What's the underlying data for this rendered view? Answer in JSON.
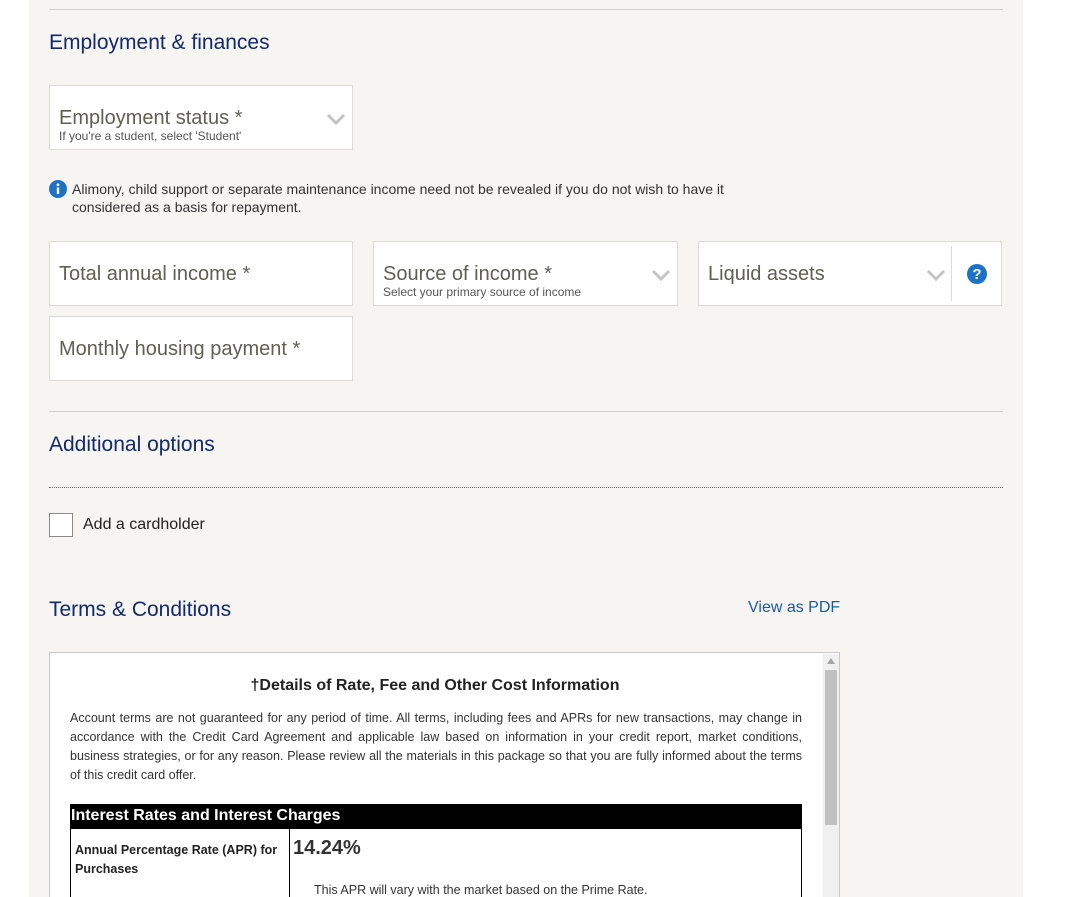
{
  "employment": {
    "heading": "Employment & finances",
    "status_label": "Employment status *",
    "status_hint": "If you're a student, select 'Student'",
    "info_text": "Alimony, child support or separate maintenance income need not be revealed if you do not wish to have it considered as a basis for repayment.",
    "annual_income_label": "Total annual income *",
    "source_label": "Source of income *",
    "source_hint": "Select your primary source of income",
    "liquid_label": "Liquid assets",
    "housing_label": "Monthly housing payment *"
  },
  "additional": {
    "heading": "Additional options",
    "cardholder_label": "Add a cardholder"
  },
  "terms": {
    "heading": "Terms & Conditions",
    "pdf_link": "View as PDF",
    "doc_title": "†Details of Rate, Fee and Other Cost Information",
    "doc_body": "Account terms are not guaranteed for any period of time. All terms, including fees and APRs for new transactions, may change in accordance with the Credit Card Agreement and applicable law based on information in your credit report, market conditions, business strategies, or for any reason. Please review all the materials in this package so that you are fully informed about the terms of this credit card offer.",
    "table_header": "Interest Rates and Interest Charges",
    "apr_label": "Annual Percentage Rate (APR) for Purchases",
    "apr_value": "14.24%",
    "apr_note": "This APR will vary with the market based on the Prime Rate."
  },
  "colors": {
    "heading": "#12296b",
    "link": "#1a5aa8",
    "info_icon": "#1d72c8",
    "panel_bg": "#f6f5f2"
  },
  "icons": {
    "dropdown": "chevron-down-icon",
    "info": "info-icon",
    "help": "question-icon"
  }
}
